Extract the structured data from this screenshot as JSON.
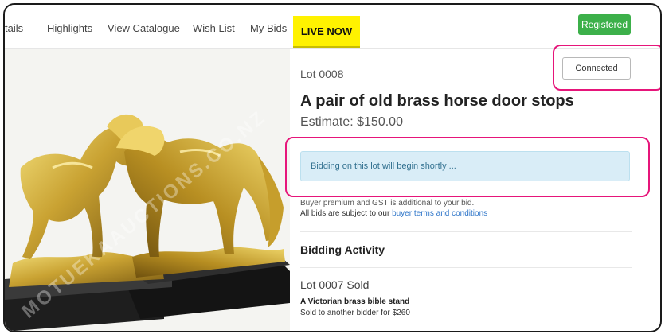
{
  "nav": {
    "items": [
      "tails",
      "Highlights",
      "View Catalogue",
      "Wish List",
      "My Bids"
    ],
    "live_label": "LIVE NOW",
    "registered_label": "Registered"
  },
  "image": {
    "watermark": "MOTUEKAAUCTIONS.CO.NZ"
  },
  "lot": {
    "number": "Lot 0008",
    "connected_label": "Connected",
    "title": "A pair of old brass horse door stops",
    "estimate": "Estimate: $150.00",
    "notice": "Bidding on this lot will begin shortly ...",
    "premium_note": "Buyer premium and GST is additional to your bid.",
    "terms_prefix": "All bids are subject to our ",
    "terms_link": "buyer terms and conditions"
  },
  "activity": {
    "heading": "Bidding Activity",
    "sold_heading": "Lot 0007 Sold",
    "sold_title": "A Victorian brass bible stand",
    "sold_detail": "Sold to another bidder for $260"
  },
  "colors": {
    "live": "#fff200",
    "registered": "#3cb04a",
    "notice_bg": "#d9edf7",
    "highlight": "#e6157a",
    "link": "#2a73c8"
  }
}
